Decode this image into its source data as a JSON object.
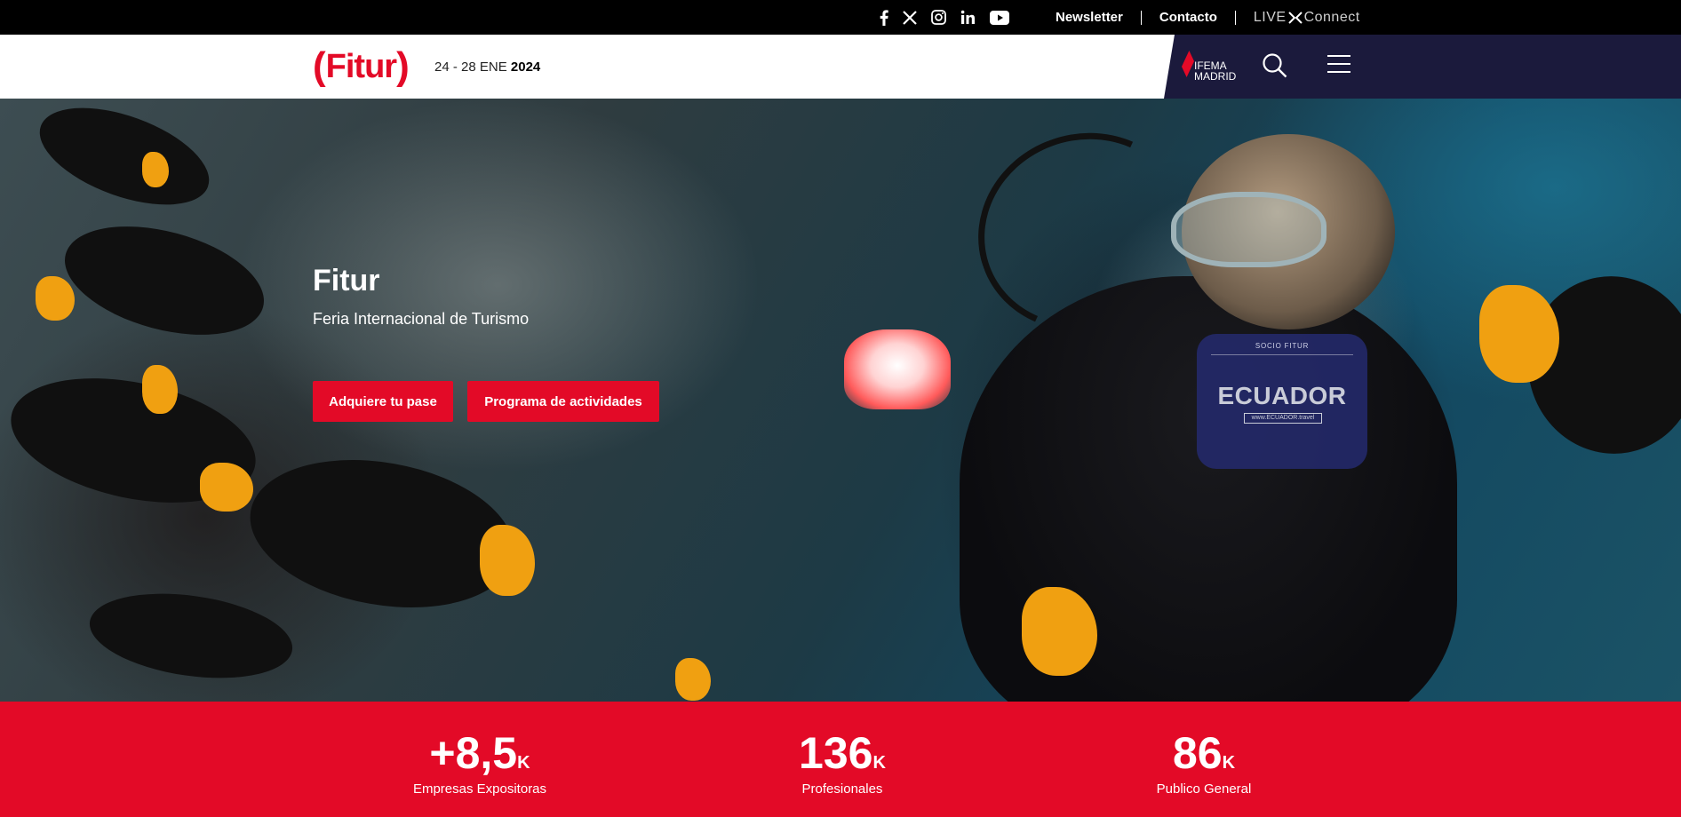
{
  "topbar": {
    "social": [
      {
        "name": "facebook-icon"
      },
      {
        "name": "x-icon"
      },
      {
        "name": "instagram-icon"
      },
      {
        "name": "linkedin-icon"
      },
      {
        "name": "youtube-icon"
      }
    ],
    "links": {
      "newsletter": "Newsletter",
      "contact": "Contacto"
    },
    "live": {
      "left": "LIVE",
      "right": "Connect"
    }
  },
  "header": {
    "logo": "Fitur",
    "dates_range": "24 - 28 ENE",
    "dates_year": "2024",
    "partner": {
      "line1": "IFEMA",
      "line2": "MADRID"
    }
  },
  "hero": {
    "title": "Fitur",
    "subtitle": "Feria Internacional de Turismo",
    "buttons": {
      "pass": "Adquiere tu pase",
      "program": "Programa de actividades"
    },
    "sponsor": {
      "label": "SOCIO FITUR",
      "brand": "ECUADOR",
      "url": "www.ECUADOR.travel"
    }
  },
  "stats": [
    {
      "value": "+8,5",
      "unit": "K",
      "label": "Empresas Expositoras"
    },
    {
      "value": "136",
      "unit": "K",
      "label": "Profesionales"
    },
    {
      "value": "86",
      "unit": "K",
      "label": "Publico General"
    }
  ],
  "colors": {
    "brand_red": "#e30a27",
    "navy": "#1b1a3c",
    "topbar": "#000000"
  }
}
